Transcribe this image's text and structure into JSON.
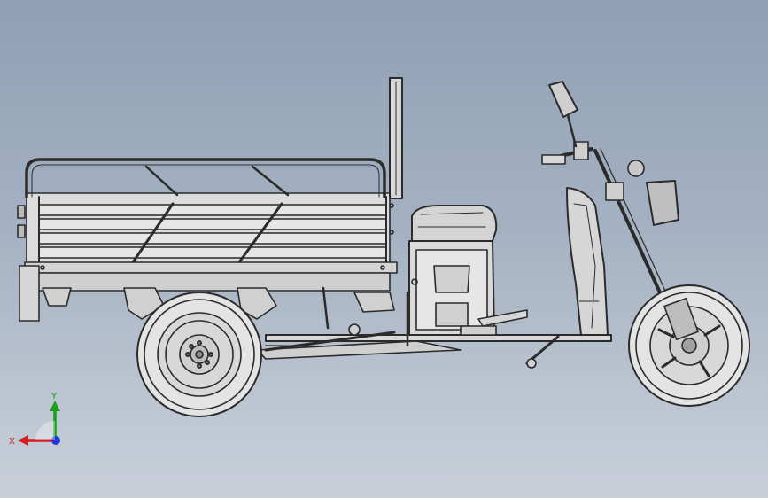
{
  "viewport": {
    "background_top": "#8f9fb4",
    "background_bottom": "#c8cfd9"
  },
  "model": {
    "line_color": "#2b2b2b",
    "fill_color": "#e8e8e8",
    "shade_color": "#c9c9c9"
  },
  "triad": {
    "x_label": "X",
    "y_label": "Y",
    "x_color": "#d11d1d",
    "y_color": "#18a018",
    "z_color": "#1f37d6"
  }
}
